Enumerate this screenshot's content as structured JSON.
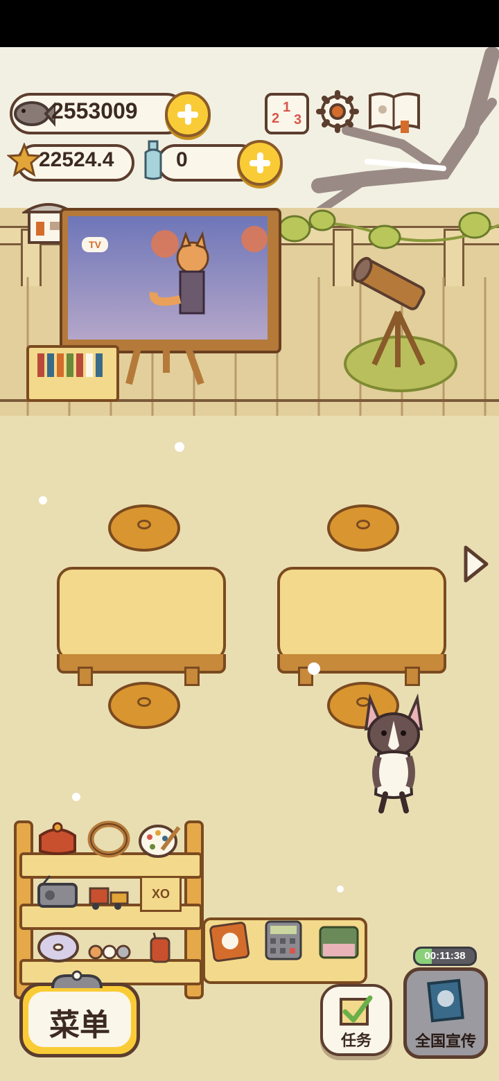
{
  "currency": {
    "fish": {
      "value": "2553009",
      "icon": "fish-icon"
    },
    "star": {
      "value": "22524.4",
      "icon": "star-icon"
    },
    "bottle": {
      "value": "0",
      "icon": "bottle-icon"
    }
  },
  "top_icons": [
    "podium-icon",
    "gear-icon",
    "book-icon"
  ],
  "podium": {
    "digits": [
      "2",
      "1",
      "3"
    ]
  },
  "tv_board": {
    "sign_text": "TV"
  },
  "shelf_items": {
    "sign_text": "XO"
  },
  "buttons": {
    "menu_label": "菜单",
    "tasks_label": "任务",
    "promo_label": "全国宣传",
    "promo_timer": "00:11:38"
  },
  "colors": {
    "accent_yellow": "#f9cc37",
    "outline_brown": "#5b3d2e",
    "floor": "#e9deb2"
  }
}
